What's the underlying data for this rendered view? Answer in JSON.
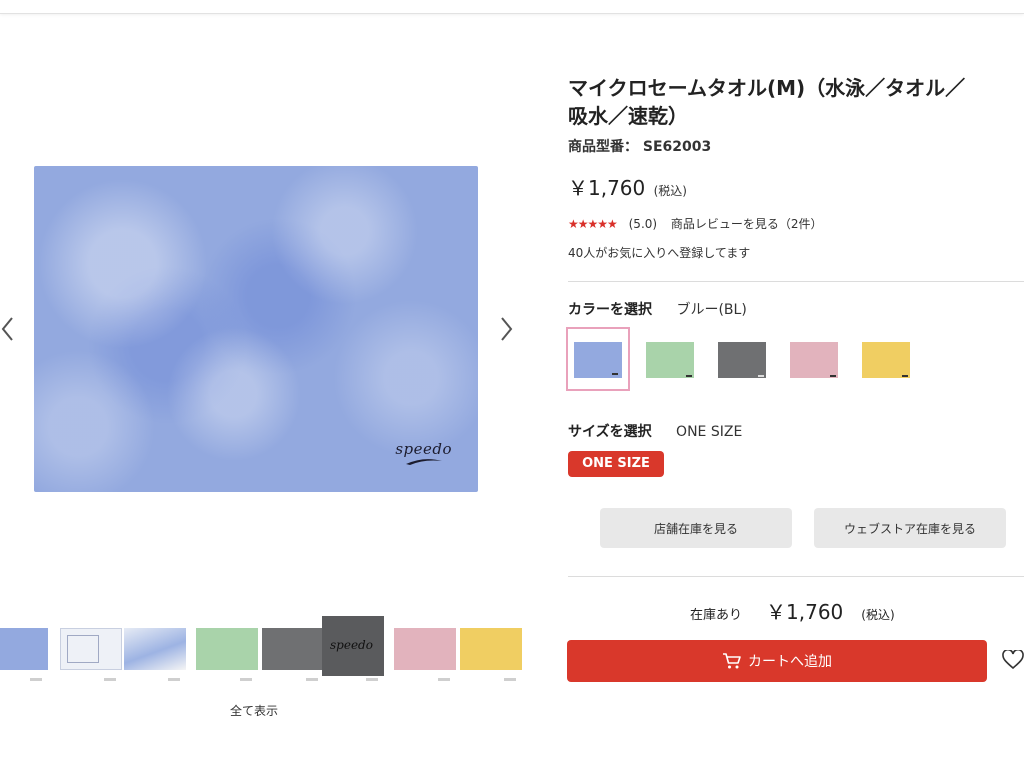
{
  "product": {
    "title_line1": "マイクロセームタオル(M)（水泳／タオル／",
    "title_line2": "吸水／速乾）",
    "model_label": "商品型番：",
    "model_number": "SE62003",
    "price": "￥1,760",
    "tax_label": "(税込)",
    "stars": "★★★★★",
    "rating": "(5.0)",
    "review_link": "商品レビューを見る（2件）",
    "favorites": "40人がお気に入りへ登録してます"
  },
  "main_image": {
    "logo_text": "speedo"
  },
  "color": {
    "label": "カラーを選択",
    "selected": "ブルー(BL)",
    "options": [
      {
        "name": "blue",
        "color": "#93a9df"
      },
      {
        "name": "green",
        "color": "#a9d3aa"
      },
      {
        "name": "gray",
        "color": "#6f7072"
      },
      {
        "name": "pink",
        "color": "#e2b3bd"
      },
      {
        "name": "yellow",
        "color": "#f0ce62"
      }
    ]
  },
  "size": {
    "label": "サイズを選択",
    "selected": "ONE SIZE",
    "button": "ONE SIZE"
  },
  "stock": {
    "store_button": "店舗在庫を見る",
    "web_button": "ウェブストア在庫を見る",
    "status": "在庫あり",
    "price": "￥1,760",
    "tax": "(税込)"
  },
  "cart": {
    "button": "カートへ追加"
  },
  "gallery": {
    "show_all": "全て表示",
    "thumb_logo": "speedo"
  },
  "colors": {
    "accent": "#d9382b",
    "selected_border": "#e9a1bb"
  }
}
